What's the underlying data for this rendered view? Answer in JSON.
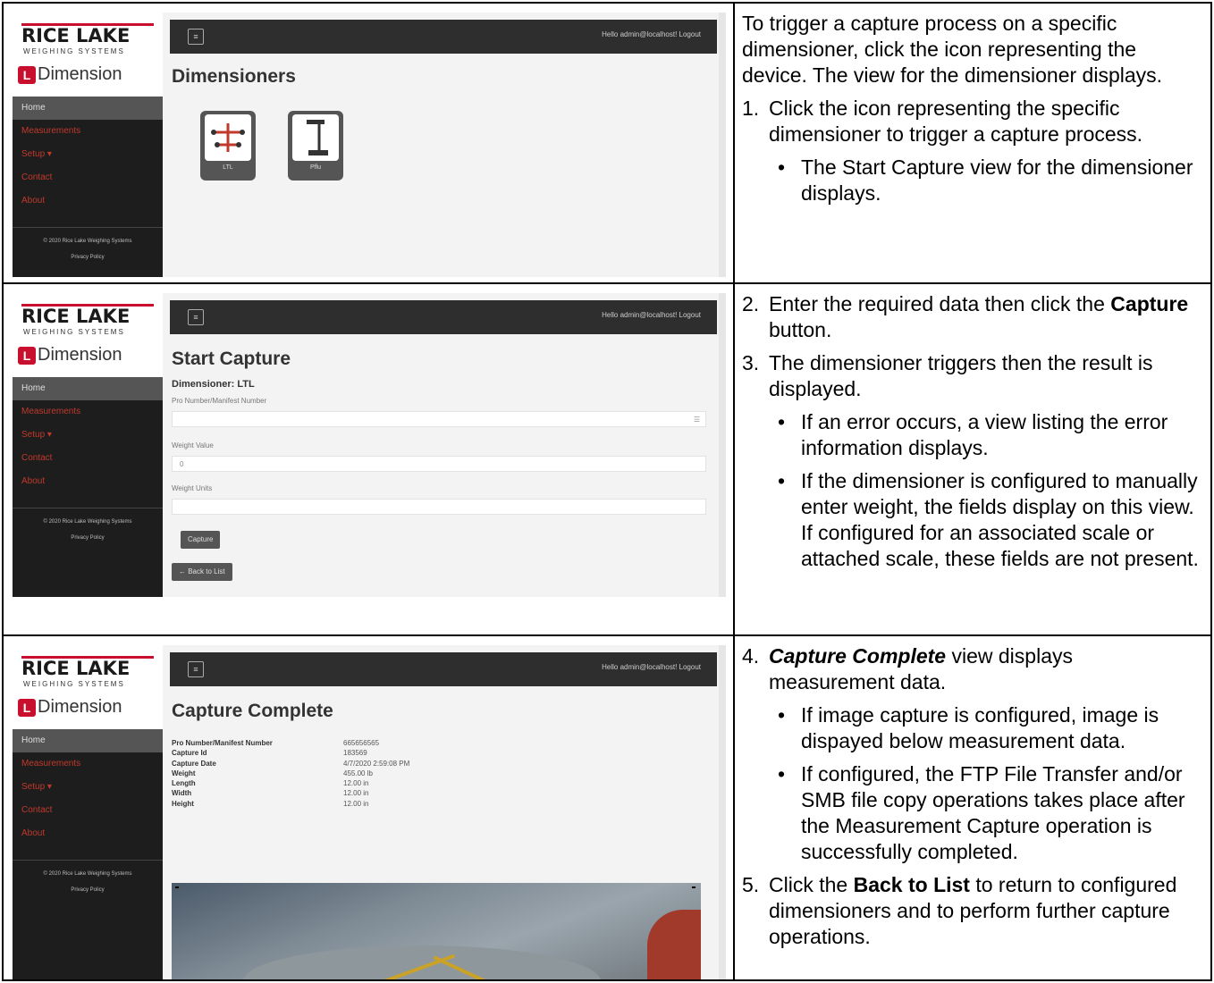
{
  "app": {
    "brand_main": "RICE LAKE",
    "brand_sub": "WEIGHING SYSTEMS",
    "product": "Dimension",
    "hello_text": "Hello admin@localhost!  Logout",
    "nav": [
      "Home",
      "Measurements",
      "Setup ▾",
      "Contact",
      "About"
    ],
    "footer_copyright": "© 2020 Rice Lake Weighing Systems",
    "footer_privacy": "Privacy Policy"
  },
  "row1": {
    "screen_title": "Dimensioners",
    "tiles": [
      {
        "label": "LTL"
      },
      {
        "label": "Pflu"
      }
    ],
    "intro": "To trigger a capture process on a specific dimensioner, click the icon representing the device. The view for the dimensioner displays.",
    "step1_num": "1.",
    "step1": "Click the icon representing the specific dimensioner to trigger a capture process.",
    "step1_bullet": "The Start Capture view for the dimensioner displays."
  },
  "row2": {
    "screen_title": "Start Capture",
    "dimensioner_label": "Dimensioner: LTL",
    "field1_label": "Pro Number/Manifest Number",
    "field2_label": "Weight Value",
    "field2_value": "0",
    "field3_label": "Weight Units",
    "capture_button": "Capture",
    "back_button": "← Back to List",
    "step2_num": "2.",
    "step2_pre": "Enter the required data then click the ",
    "step2_bold": "Capture",
    "step2_post": " button.",
    "step3_num": "3.",
    "step3": "The dimensioner triggers then the result is displayed.",
    "step3_bullet1": "If an error occurs, a view listing the error information displays.",
    "step3_bullet2a": "If the dimensioner is configured to manually enter weight, the fields display on this view.",
    "step3_bullet2b": "If configured for an associated scale or attached scale, these fields are not present."
  },
  "row3": {
    "screen_title": "Capture Complete",
    "fields": [
      {
        "k": "Pro Number/Manifest Number",
        "v": "665656565"
      },
      {
        "k": "Capture Id",
        "v": "183569"
      },
      {
        "k": "Capture Date",
        "v": "4/7/2020 2:59:08 PM"
      },
      {
        "k": "Weight",
        "v": "455.00 lb"
      },
      {
        "k": "Length",
        "v": "12.00 in"
      },
      {
        "k": "Width",
        "v": "12.00 in"
      },
      {
        "k": "Height",
        "v": "12.00 in"
      }
    ],
    "step4_num": "4.",
    "step4_bold": "Capture Complete",
    "step4_post": " view displays measurement data.",
    "step4_bullet1": "If image capture is configured, image is dispayed below measurement data.",
    "step4_bullet2": "If configured, the FTP File Transfer and/or SMB file copy operations takes place after the Measurement Capture operation is successfully completed.",
    "step5_num": "5.",
    "step5_pre": "Click the ",
    "step5_bold": "Back to List",
    "step5_post": " to return to configured dimensioners and to perform further capture operations."
  }
}
